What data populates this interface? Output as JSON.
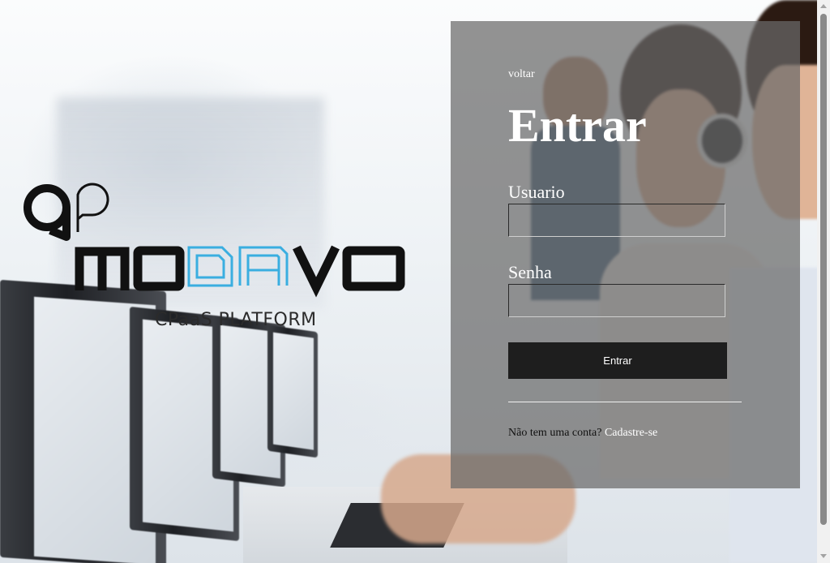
{
  "logo": {
    "brand": "MODAVO",
    "tagline": "CPaaS PLATFORM",
    "mark": "ap"
  },
  "login": {
    "back_label": "voltar",
    "title": "Entrar",
    "username_label": "Usuario",
    "username_value": "",
    "password_label": "Senha",
    "password_value": "",
    "submit_label": "Entrar",
    "signup_prompt": "Não tem uma conta?",
    "signup_link": "Cadastre-se"
  },
  "colors": {
    "panel": "#696969",
    "button": "#1e1e1e",
    "brand_accent": "#3aaee0",
    "brand_dark": "#111111"
  }
}
